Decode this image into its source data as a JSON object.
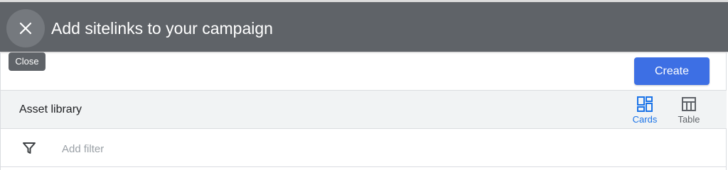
{
  "header": {
    "title": "Add sitelinks to your campaign",
    "close_tooltip": "Close"
  },
  "toolbar": {
    "create_label": "Create"
  },
  "library": {
    "title": "Asset library",
    "views": [
      {
        "label": "Cards",
        "icon": "cards-view-icon",
        "active": true
      },
      {
        "label": "Table",
        "icon": "table-view-icon",
        "active": false
      }
    ]
  },
  "filter": {
    "placeholder": "Add filter",
    "icon": "filter-icon"
  },
  "colors": {
    "header_bg": "#5f6368",
    "accent": "#1a73e8",
    "create_button": "#3d6fe4"
  }
}
